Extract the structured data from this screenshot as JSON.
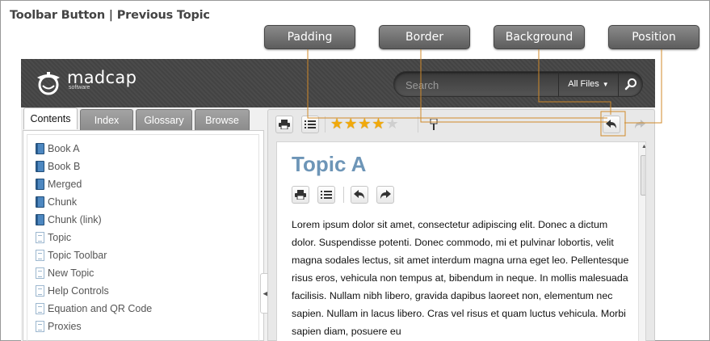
{
  "doc": {
    "title": "Toolbar Button  |  Previous Topic"
  },
  "callouts": {
    "padding": "Padding",
    "border": "Border",
    "background": "Background",
    "position": "Position"
  },
  "header": {
    "logo_name": "madcap",
    "logo_sub": "software",
    "search_placeholder": "Search",
    "search_filter": "All Files",
    "search_filter_arrow": "▼"
  },
  "tabs": [
    {
      "label": "Contents",
      "active": true
    },
    {
      "label": "Index",
      "active": false
    },
    {
      "label": "Glossary",
      "active": false
    },
    {
      "label": "Browse",
      "active": false
    }
  ],
  "toc": [
    {
      "label": "Book A",
      "icon": "book-icon"
    },
    {
      "label": "Book B",
      "icon": "book-icon"
    },
    {
      "label": "Merged",
      "icon": "book-icon"
    },
    {
      "label": "Chunk",
      "icon": "book-icon"
    },
    {
      "label": "Chunk (link)",
      "icon": "book-icon"
    },
    {
      "label": "Topic",
      "icon": "page-icon"
    },
    {
      "label": "Topic Toolbar",
      "icon": "page-icon"
    },
    {
      "label": "New Topic",
      "icon": "page-icon"
    },
    {
      "label": "Help Controls",
      "icon": "page-icon"
    },
    {
      "label": "Equation and QR Code",
      "icon": "page-icon"
    },
    {
      "label": "Proxies",
      "icon": "page-icon"
    }
  ],
  "toolbar": {
    "rating": 4,
    "rating_max": 5
  },
  "article": {
    "title": "Topic A",
    "body": "Lorem ipsum dolor sit amet, consectetur adipiscing elit. Donec a dictum dolor. Suspendisse potenti. Donec commodo, mi et pulvinar lobortis, velit magna sodales lectus, sit amet interdum magna urna eget leo. Pellentesque risus eros, vehicula non tempus at, bibendum in neque. In mollis malesuada facilisis. Nullam nibh libero, gravida dapibus laoreet non, elementum nec sapien. Nullam in lacus libero. Cras vel risus et quam luctus vehicula. Morbi sapien diam, posuere eu"
  },
  "colors": {
    "header_bg": "#4b4b4b",
    "topic_title": "#6d95b7",
    "callout_line": "#d08a2a",
    "star": "#f1a90b"
  }
}
